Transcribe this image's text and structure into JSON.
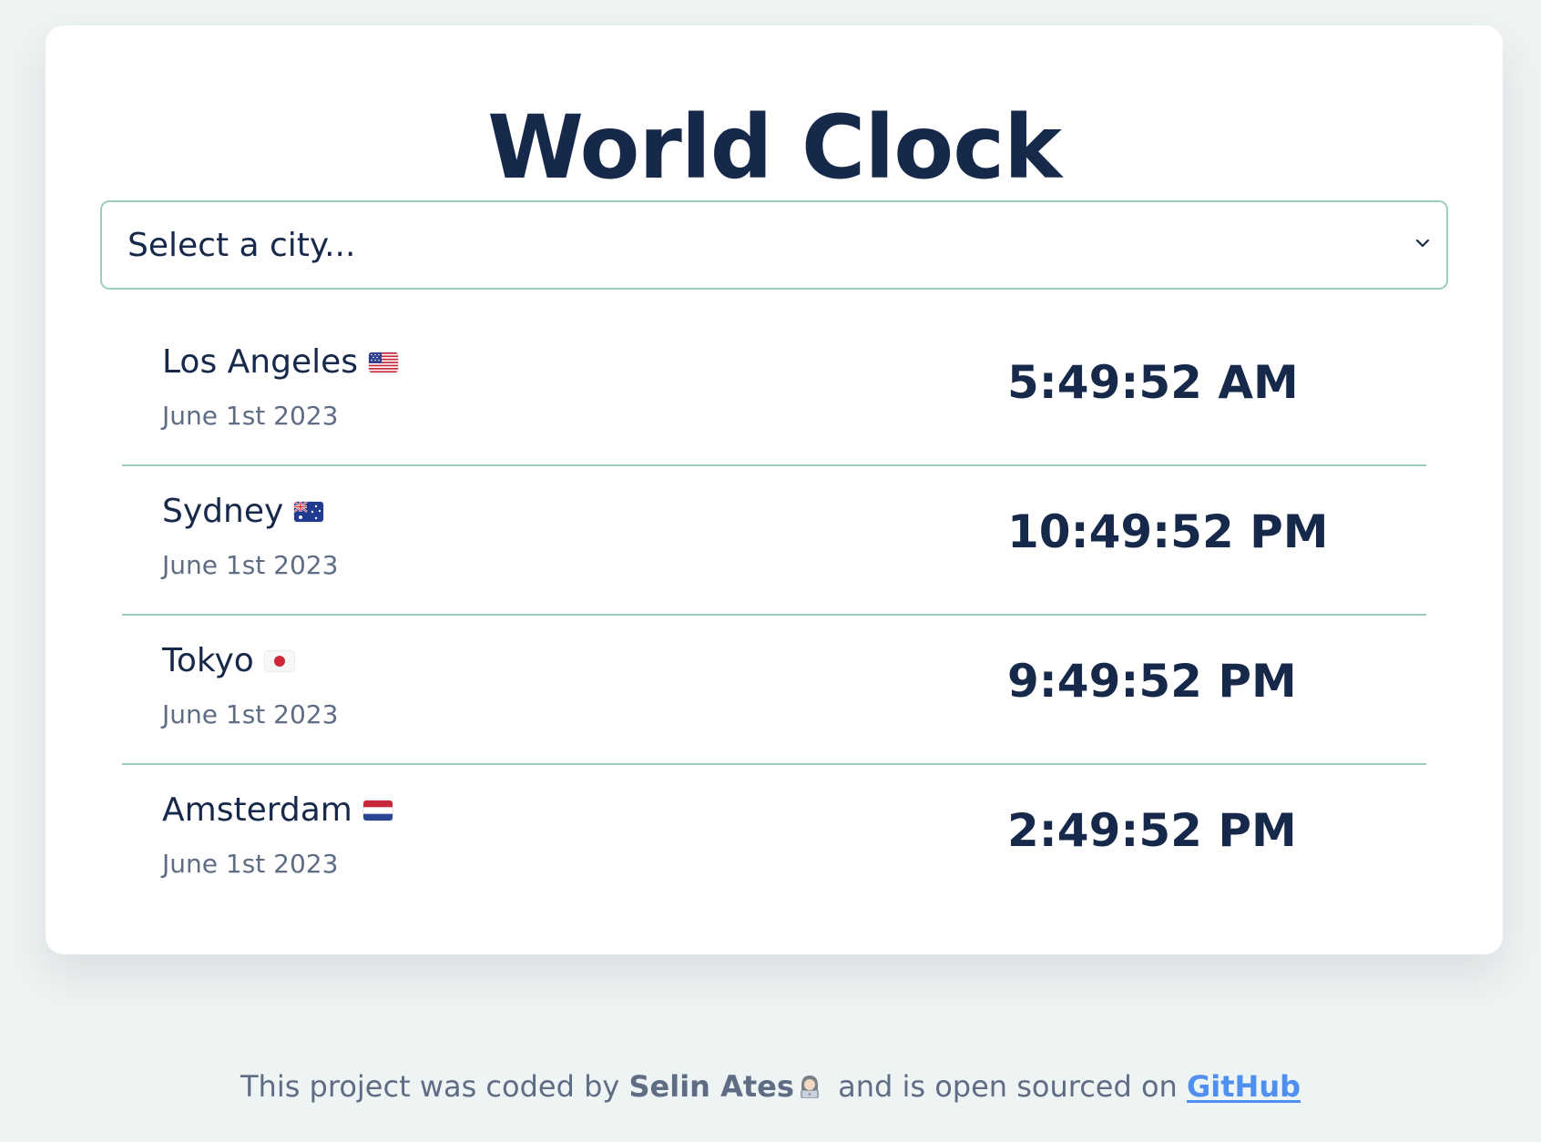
{
  "app": {
    "title": "World Clock"
  },
  "select": {
    "placeholder": "Select a city..."
  },
  "cities": [
    {
      "name": "Los Angeles",
      "flag": "US",
      "date": "June 1st 2023",
      "time": "5:49:52 AM"
    },
    {
      "name": "Sydney",
      "flag": "AU",
      "date": "June 1st 2023",
      "time": "10:49:52 PM"
    },
    {
      "name": "Tokyo",
      "flag": "JP",
      "date": "June 1st 2023",
      "time": "9:49:52 PM"
    },
    {
      "name": "Amsterdam",
      "flag": "NL",
      "date": "June 1st 2023",
      "time": "2:49:52 PM"
    }
  ],
  "footer": {
    "prefix": "This project was coded by",
    "author": "Selin Ates",
    "author_emoji": "woman-technologist-icon",
    "middle": "and is open sourced on",
    "link_text": "GitHub"
  },
  "colors": {
    "background": "#eef3f3",
    "card": "#ffffff",
    "heading": "#17294a",
    "muted": "#5f6d84",
    "divider": "#9bcfbc",
    "link": "#4f8ff0"
  }
}
